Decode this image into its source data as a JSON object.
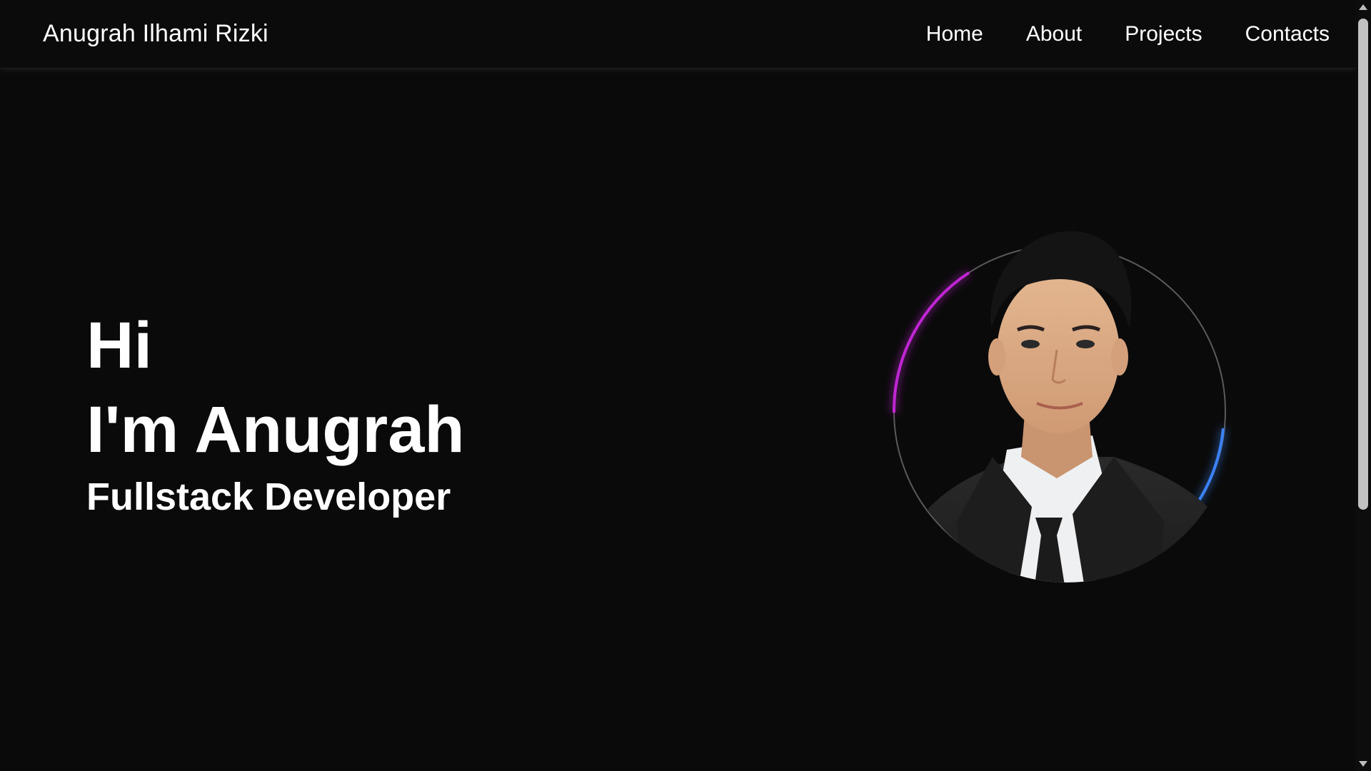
{
  "header": {
    "brand": "Anugrah Ilhami Rizki",
    "nav": [
      "Home",
      "About",
      "Projects",
      "Contacts"
    ]
  },
  "hero": {
    "greeting": "Hi",
    "name_line": "I'm Anugrah",
    "role": "Fullstack Developer"
  },
  "colors": {
    "background": "#0a0a0a",
    "text": "#ffffff",
    "ring_magenta": "#c026d3",
    "ring_blue": "#3b82f6"
  },
  "icons": {
    "portrait": "profile-photo"
  }
}
